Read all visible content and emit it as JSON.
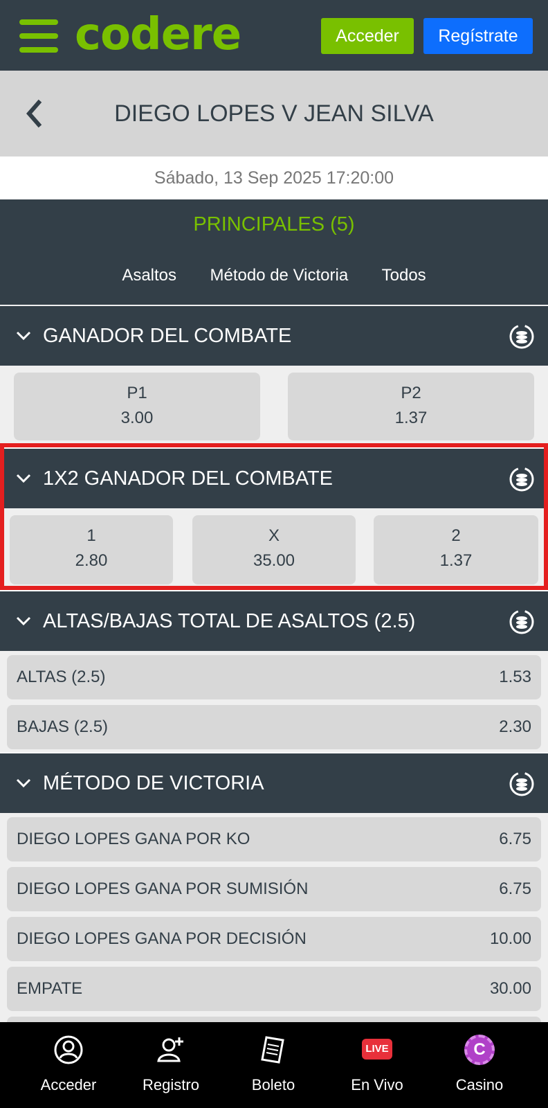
{
  "header": {
    "logo": "codere",
    "login_label": "Acceder",
    "register_label": "Regístrate"
  },
  "event": {
    "title": "DIEGO LOPES V JEAN SILVA",
    "date": "Sábado, 13 Sep 2025 17:20:00"
  },
  "tabs": {
    "main": "PRINCIPALES (5)",
    "items": [
      "Asaltos",
      "Método de Victoria",
      "Todos"
    ]
  },
  "markets": {
    "winner": {
      "title": "GANADOR DEL COMBATE",
      "odds": [
        {
          "label": "P1",
          "value": "3.00"
        },
        {
          "label": "P2",
          "value": "1.37"
        }
      ]
    },
    "one_x_two": {
      "title": "1X2 GANADOR DEL COMBATE",
      "odds": [
        {
          "label": "1",
          "value": "2.80"
        },
        {
          "label": "X",
          "value": "35.00"
        },
        {
          "label": "2",
          "value": "1.37"
        }
      ]
    },
    "over_under": {
      "title": "ALTAS/BAJAS TOTAL DE ASALTOS (2.5)",
      "rows": [
        {
          "label": "ALTAS (2.5)",
          "value": "1.53"
        },
        {
          "label": "BAJAS (2.5)",
          "value": "2.30"
        }
      ]
    },
    "method": {
      "title": "MÉTODO DE VICTORIA",
      "rows": [
        {
          "label": "DIEGO LOPES GANA POR KO",
          "value": "6.75"
        },
        {
          "label": "DIEGO LOPES GANA POR SUMISIÓN",
          "value": "6.75"
        },
        {
          "label": "DIEGO LOPES GANA POR DECISIÓN",
          "value": "10.00"
        },
        {
          "label": "EMPATE",
          "value": "30.00"
        }
      ]
    }
  },
  "bottom_nav": {
    "items": [
      {
        "label": "Acceder",
        "icon": "user-icon"
      },
      {
        "label": "Registro",
        "icon": "add-user-icon"
      },
      {
        "label": "Boleto",
        "icon": "ticket-icon"
      },
      {
        "label": "En Vivo",
        "icon": "live-icon",
        "badge": "LIVE"
      },
      {
        "label": "Casino",
        "icon": "casino-chip-icon",
        "badge": "C"
      }
    ]
  },
  "colors": {
    "brand_green": "#79c000",
    "header_dark": "#333f48",
    "register_blue": "#0d6efd",
    "highlight_red": "#e41f1f",
    "live_red": "#e8303a",
    "casino_purple": "#b040c8"
  }
}
